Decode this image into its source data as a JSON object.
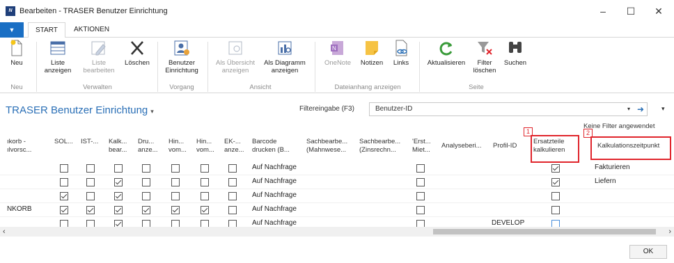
{
  "window": {
    "app_logo": "N",
    "title": "Bearbeiten - TRASER Benutzer Einrichtung",
    "minimize": "–",
    "maximize": "☐",
    "close": "✕"
  },
  "tabs": {
    "file": "▼",
    "start": "START",
    "aktionen": "AKTIONEN"
  },
  "ribbon": {
    "neu": "Neu",
    "liste_anzeigen": "Liste anzeigen",
    "liste_bearbeiten": "Liste bearbeiten",
    "loeschen": "Löschen",
    "benutzer_einrichtung": "Benutzer Einrichtung",
    "als_uebersicht_anzeigen": "Als Übersicht anzeigen",
    "als_diagramm_anzeigen": "Als Diagramm anzeigen",
    "onenote": "OneNote",
    "notizen": "Notizen",
    "links": "Links",
    "aktualisieren": "Aktualisieren",
    "filter_loeschen": "Filter löschen",
    "suchen": "Suchen",
    "groups": {
      "neu": "Neu",
      "verwalten": "Verwalten",
      "vorgang": "Vorgang",
      "ansicht": "Ansicht",
      "dateianhang": "Dateianhang anzeigen",
      "seite": "Seite"
    }
  },
  "page": {
    "title": "TRASER Benutzer Einrichtung",
    "title_caret": "▾",
    "filter_label": "Filtereingabe (F3)",
    "filter_value": "Benutzer-ID",
    "filter_dropdown": "▾",
    "filter_go": "➜",
    "filter_more": "▾",
    "no_filter": "Keine Filter angewendet"
  },
  "columns": {
    "c1": "ıkorb - ılvorsc...",
    "c2": "SOL...",
    "c3": "IST-...",
    "c4": "Kalk... bear...",
    "c5": "Dru... anze...",
    "c6": "Hin... vom...",
    "c7": "Hin... vom...",
    "c8": "EK-... anze...",
    "c9": "Barcode drucken (B...",
    "c10": "Sachbearbe... (Mahnwese...",
    "c11": "Sachbearbe... (Zinsrechn...",
    "c12": "'Erst... Miet...",
    "c13": "Analyseberi...",
    "c14": "Profil-ID",
    "c15": "Ersatzteile kalkulieren",
    "c16": "Kalkulationszeitpunkt"
  },
  "markers": {
    "m1": "1",
    "m2": "2"
  },
  "rows": [
    {
      "c1": "",
      "barcode": "Auf Nachfrage",
      "profil": "",
      "kalkzeit": "Fakturieren"
    },
    {
      "c1": "",
      "barcode": "Auf Nachfrage",
      "profil": "",
      "kalkzeit": "Liefern"
    },
    {
      "c1": "",
      "barcode": "Auf Nachfrage",
      "profil": "",
      "kalkzeit": ""
    },
    {
      "c1": "NKORB",
      "barcode": "Auf Nachfrage",
      "profil": "",
      "kalkzeit": ""
    },
    {
      "c1": "",
      "barcode": "Auf Nachfrage",
      "profil": "DEVELOP",
      "kalkzeit": ""
    }
  ],
  "checkbox_states": [
    {
      "sol": false,
      "ist": false,
      "kalk": false,
      "dru": false,
      "hin1": false,
      "hin2": false,
      "ek": false,
      "erst": false,
      "ersatz": true
    },
    {
      "sol": false,
      "ist": false,
      "kalk": true,
      "dru": false,
      "hin1": false,
      "hin2": false,
      "ek": false,
      "erst": false,
      "ersatz": true
    },
    {
      "sol": true,
      "ist": false,
      "kalk": true,
      "dru": false,
      "hin1": false,
      "hin2": false,
      "ek": false,
      "erst": false,
      "ersatz": false
    },
    {
      "sol": true,
      "ist": true,
      "kalk": true,
      "dru": true,
      "hin1": true,
      "hin2": true,
      "ek": false,
      "erst": false,
      "ersatz": false
    },
    {
      "sol": false,
      "ist": false,
      "kalk": true,
      "dru": false,
      "hin1": false,
      "hin2": false,
      "ek": false,
      "erst": false,
      "ersatz": false
    }
  ],
  "scroll": {
    "left": "‹",
    "right": "›"
  },
  "footer": {
    "ok": "OK"
  },
  "colors": {
    "accent": "#2a6fb6",
    "file_tab": "#1a6fc4",
    "highlight": "#e0242b"
  }
}
